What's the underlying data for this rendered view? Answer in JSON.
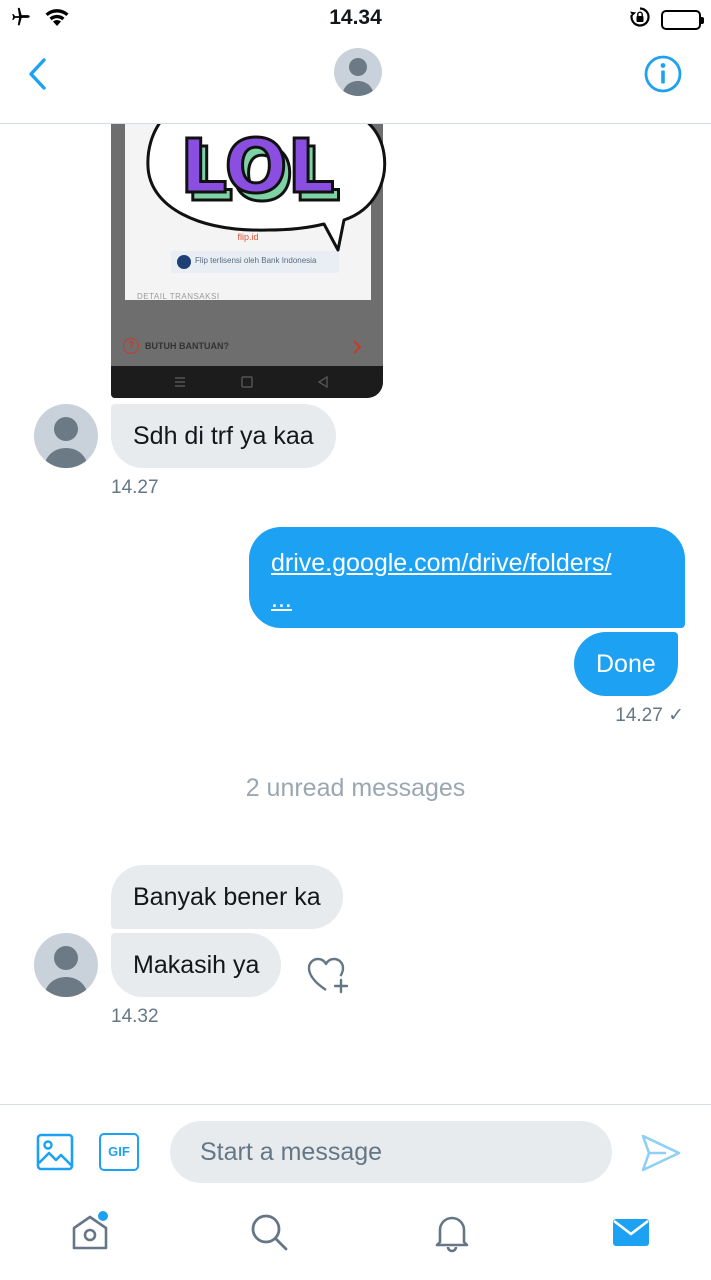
{
  "status_bar": {
    "time": "14.34",
    "icons": [
      "airplane-icon",
      "wifi-icon",
      "rotation-lock-icon",
      "battery-icon"
    ]
  },
  "header": {
    "icons": [
      "back-chevron-icon",
      "avatar-icon",
      "info-icon"
    ]
  },
  "shared_image": {
    "sticker_text": "LOL",
    "domain_text": "flip.id",
    "bank_text": "Flip terlisensi oleh Bank Indonesia",
    "detail_text": "DETAIL TRANSAKSI",
    "help_text": "BUTUH BANTUAN?",
    "help_icon": "?"
  },
  "messages": [
    {
      "direction": "in",
      "text": "Sdh di trf ya kaa",
      "time": "14.27"
    },
    {
      "direction": "out",
      "link_line1": "drive.google.com/drive/folders/",
      "link_line2": "...",
      "text": "Done",
      "time": "14.27 ✓"
    },
    {
      "direction": "in",
      "texts": [
        "Banyak bener ka",
        "Makasih ya"
      ],
      "time": "14.32"
    }
  ],
  "unread_label": "2 unread messages",
  "composer": {
    "gif_label": "GIF",
    "placeholder": "Start a message"
  },
  "tabbar": {
    "items": [
      "home-icon",
      "search-icon",
      "notifications-icon",
      "messages-icon"
    ]
  },
  "colors": {
    "accent": "#1da1f2",
    "bubble_in": "#e7ebee",
    "timestamp": "#657786"
  }
}
